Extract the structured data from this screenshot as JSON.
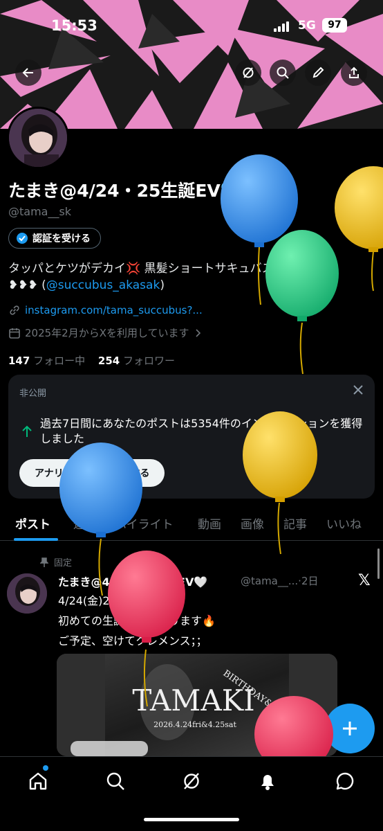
{
  "status_bar": {
    "time": "15:53",
    "network": "5G",
    "battery": "97"
  },
  "profile": {
    "display_name": "たまき@4/24・25生誕EV🩵",
    "handle": "@tama__sk",
    "verify_label": "認証を受ける",
    "bio_line1": "タッパとケツがデカイ💢 黒髪ショートサキュバス🩵⛓️",
    "bio_line2_prefix": "❥❥❥ (",
    "bio_mention": "@succubus_akasak",
    "bio_line2_suffix": ")",
    "link": "instagram.com/tama_succubus?...",
    "joined": "2025年2月からXを利用しています",
    "following_count": "147",
    "following_label": "フォロー中",
    "followers_count": "254",
    "followers_label": "フォロワー"
  },
  "private_card": {
    "title": "非公開",
    "message": "過去7日間にあなたのポストは5354件のインプレッションを獲得しました",
    "button": "アナリティクスを利用する"
  },
  "tabs": [
    "ポスト",
    "返信",
    "ハイライト",
    "動画",
    "画像",
    "記事",
    "いいね"
  ],
  "pinned_post": {
    "pinned_label": "固定",
    "author": "たまき@4/24・25生誕EV🤍",
    "handle_time": "@tama__...·2日",
    "line1": "4/24(金)25(土)‼️‼️‼️",
    "line2": "初めての生誕＆周年やります🔥",
    "line3": "ご予定、空けてクレメンス；；",
    "image_title": "TAMAKI",
    "image_subtitle": "BIRTHDAY&ANNIVERSARY",
    "image_date": "2026.4.24fri&4.25sat"
  },
  "colors": {
    "accent": "#1d9bf0",
    "banner_pink": "#e88bc6"
  },
  "icons": [
    "back-icon",
    "refresh-icon",
    "search-icon",
    "edit-icon",
    "share-icon",
    "home-icon",
    "explore-icon",
    "grok-icon",
    "bell-icon",
    "messages-icon",
    "plus-icon"
  ]
}
